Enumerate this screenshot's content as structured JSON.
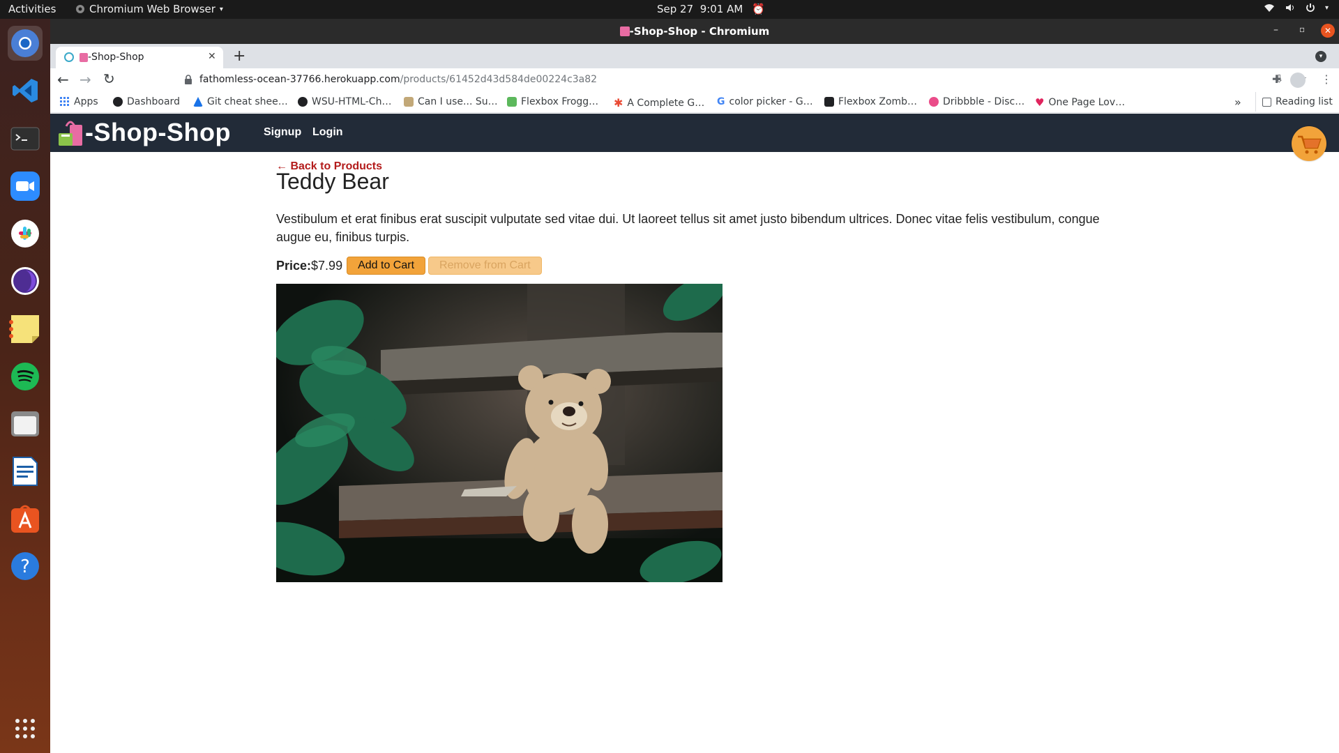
{
  "topbar": {
    "activities": "Activities",
    "app_name": "Chromium Web Browser",
    "date": "Sep 27",
    "time": "9:01 AM"
  },
  "dock": {
    "items": [
      "chromium-icon",
      "vscode-icon",
      "terminal-icon",
      "zoom-icon",
      "slack-icon",
      "tor-browser-icon",
      "sticky-notes-icon",
      "spotify-icon",
      "files-icon",
      "libreoffice-writer-icon",
      "app-store-icon",
      "help-icon"
    ],
    "show_apps_icon": "apps-grid-icon"
  },
  "window": {
    "title": "-Shop-Shop - Chromium"
  },
  "tabs": [
    {
      "title": "-Shop-Shop"
    }
  ],
  "toolbar": {
    "url_host": "fathomless-ocean-37766.herokuapp.com",
    "url_path": "/products/61452d43d584de00224c3a82"
  },
  "bookmarks": {
    "items": [
      {
        "label": "Apps",
        "color": "#4285f4"
      },
      {
        "label": "Dashboard",
        "color": "#202124"
      },
      {
        "label": "Git cheat shee…",
        "color": "#1a73e8"
      },
      {
        "label": "WSU-HTML-Ch…",
        "color": "#202124"
      },
      {
        "label": "Can I use... Su…",
        "color": "#c2a878"
      },
      {
        "label": "Flexbox Frogg…",
        "color": "#5cb85c"
      },
      {
        "label": "A Complete G…",
        "color": "#e94b35"
      },
      {
        "label": "color picker - G…",
        "color": "#4285f4"
      },
      {
        "label": "Flexbox Zomb…",
        "color": "#202124"
      },
      {
        "label": "Dribbble - Disc…",
        "color": "#ea4c89"
      },
      {
        "label": "One Page Lov…",
        "color": "#e0245e"
      }
    ],
    "more": "»",
    "reading_list": "Reading list"
  },
  "site": {
    "logo_text": "-Shop-Shop",
    "nav": [
      "Signup",
      "Login"
    ],
    "header_bg": "#222b38",
    "accent": "#f2a33a"
  },
  "product": {
    "back_link": "← Back to Products",
    "name": "Teddy Bear",
    "description": "Vestibulum et erat finibus erat suscipit vulputate sed vitae dui. Ut laoreet tellus sit amet justo bibendum ultrices. Donec vitae felis vestibulum, congue augue eu, finibus turpis.",
    "price_label": "Price:",
    "price_value": "$7.99",
    "add_button": "Add to Cart",
    "remove_button": "Remove from Cart"
  }
}
